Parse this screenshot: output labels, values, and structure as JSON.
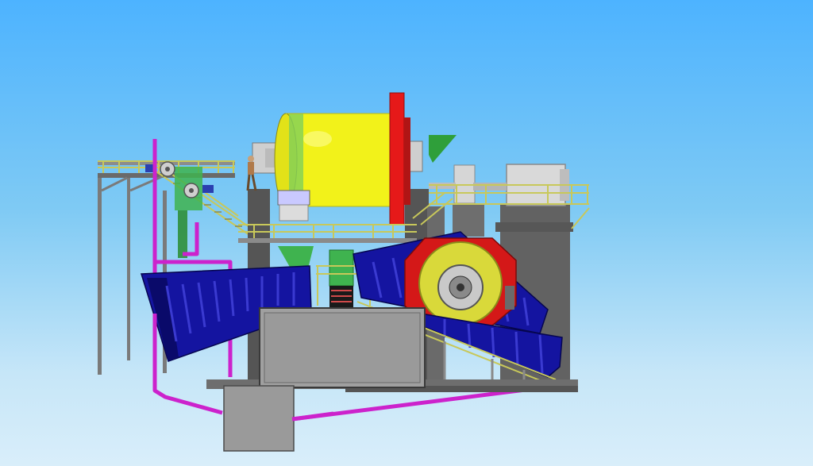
{
  "scene": {
    "subject": "grinding-mill-plant-3d-model",
    "background": {
      "sky_top": "#4db3ff",
      "sky_bottom": "#d9eefa"
    },
    "colors": {
      "mill_shell": "#f2f21a",
      "mill_flange": "#e61919",
      "classifier": "#1414a0",
      "pipe": "#cc22cc",
      "structure": "#5a5a5a",
      "housing": "#9a9a9a",
      "handrail": "#c8c85a",
      "chute": "#3fb34f"
    }
  }
}
